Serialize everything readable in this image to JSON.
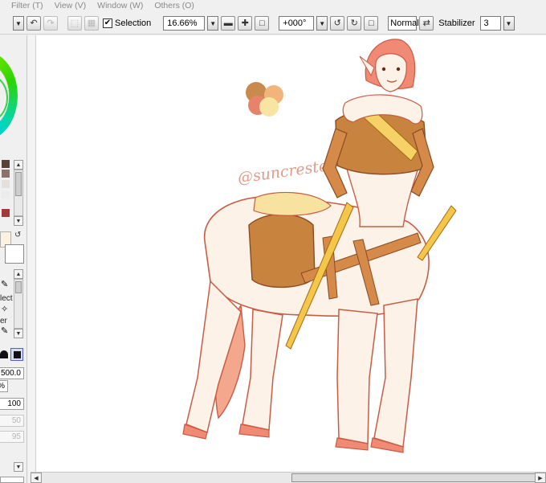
{
  "menu": [
    "Filter (T)",
    "View (V)",
    "Window (W)",
    "Others (O)"
  ],
  "toolbar": {
    "selection_label": "Selection",
    "selection_checked": true,
    "zoom_value": "16.66%",
    "rotation_value": "+000°",
    "blend_mode": "Normal",
    "stabilizer_label": "Stabilizer",
    "stabilizer_value": "3"
  },
  "left_panel": {
    "tool_partial_labels": [
      "lect",
      "er"
    ],
    "size_value": "500.0",
    "percent_value": "%",
    "density_value": "100",
    "dim_values": [
      "50",
      "95"
    ],
    "swatches": [
      "#5a4238",
      "#8a7368",
      "#c9c0bb",
      "#9e3c3c"
    ]
  },
  "canvas": {
    "signature_text": "@suncrested",
    "palette_colors": [
      "#c98a4e",
      "#f1b57c",
      "#e7836b",
      "#f8e4a3"
    ]
  }
}
